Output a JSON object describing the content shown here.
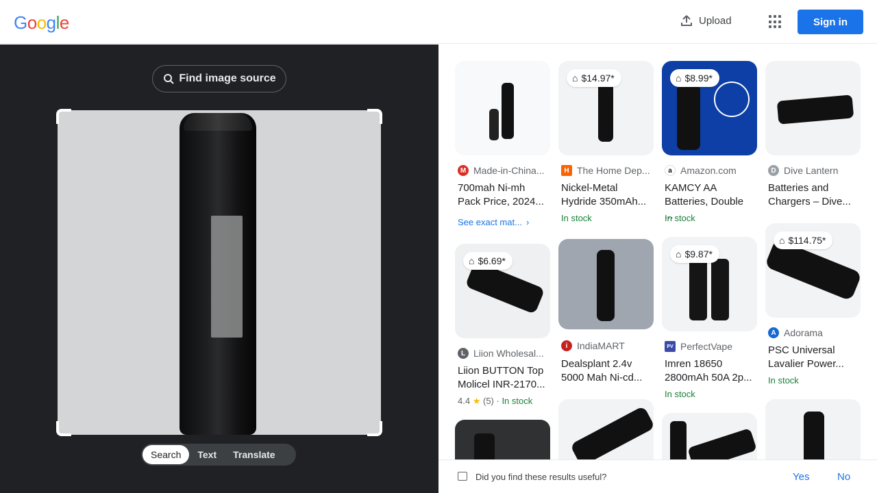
{
  "header": {
    "logo": [
      "G",
      "o",
      "o",
      "g",
      "l",
      "e"
    ],
    "logo_colors": [
      "#4285f4",
      "#ea4335",
      "#fbbc05",
      "#4285f4",
      "#34a853",
      "#ea4335"
    ],
    "upload_label": "Upload",
    "signin_label": "Sign in"
  },
  "left": {
    "find_source_label": "Find image source",
    "modes": [
      "Search",
      "Text",
      "Translate"
    ],
    "active_mode": "Search"
  },
  "results": [
    {
      "source": "Made-in-China...",
      "title": "700mah Ni-mh Pack Price, 2024...",
      "exact": "See exact mat...",
      "favicon_color": "#d93025",
      "favicon": "M"
    },
    {
      "price": "$14.97*",
      "source": "The Home Dep...",
      "title": "Nickel-Metal Hydride 350mAh...",
      "stock": "In stock",
      "favicon_color": "#f96302",
      "favicon": "H"
    },
    {
      "price": "$8.99*",
      "source": "Amazon.com",
      "title": "KAMCY AA Batteries, Double ...",
      "stock": "In stock",
      "favicon_color": "#ffffff",
      "favicon": "a"
    },
    {
      "source": "Dive Lantern",
      "title": "Batteries and Chargers – Dive...",
      "favicon_color": "#9aa0a6",
      "favicon": "D"
    },
    {
      "price": "$6.69*",
      "source": "Liion Wholesal...",
      "title": "Liion BUTTON Top Molicel INR-2170...",
      "rating": "4.4",
      "reviews": "(5)",
      "stock": "In stock",
      "favicon_color": "#5f6368",
      "favicon": "L"
    },
    {
      "source": "IndiaMART",
      "title": "Dealsplant 2.4v 5000 Mah Ni-cd...",
      "favicon_color": "#c5221f",
      "favicon": "i"
    },
    {
      "price": "$9.87*",
      "source": "PerfectVape",
      "title": "Imren 18650 2800mAh 50A 2p...",
      "stock": "In stock",
      "favicon_color": "#3c4aa8",
      "favicon": "PV"
    },
    {
      "price": "$114.75*",
      "source": "Adorama",
      "title": "PSC Universal Lavalier Power...",
      "stock": "In stock",
      "favicon_color": "#1967d2",
      "favicon": "A"
    }
  ],
  "feedback": {
    "question": "Did you find these results useful?",
    "yes": "Yes",
    "no": "No"
  }
}
